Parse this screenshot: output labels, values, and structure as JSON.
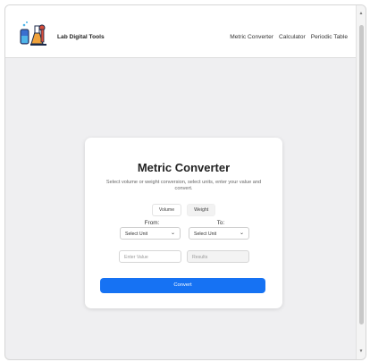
{
  "navbar": {
    "brand": "Lab Digital Tools",
    "links": [
      "Metric Converter",
      "Calculator",
      "Periodic Table"
    ]
  },
  "converter": {
    "title": "Metric Converter",
    "description": "Select volume or weight conversion, select units, enter your value and convert.",
    "tabs": [
      "Volume",
      "Weight"
    ],
    "from_label": "From:",
    "to_label": "To:",
    "from_select": "Select Unit",
    "to_select": "Select Unit",
    "value_placeholder": "Enter Value",
    "result_placeholder": "Results",
    "convert_label": "Convert"
  },
  "colors": {
    "accent": "#1672f3",
    "page_bg": "#efeff1"
  },
  "icons": {
    "logo": "lab-flask-microscope-icon"
  }
}
